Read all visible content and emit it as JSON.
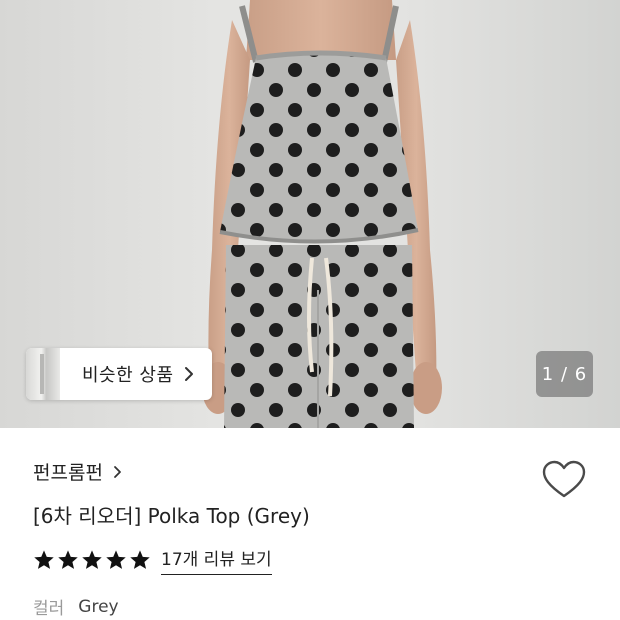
{
  "gallery": {
    "similar_button_label": "비슷한 상품",
    "page_indicator": "1 / 6",
    "current_page": 1,
    "total_pages": 6
  },
  "product": {
    "brand": "펀프롬펀",
    "title": "[6차 리오더] Polka Top (Grey)",
    "rating_stars": 5,
    "review_link": "17개 리뷰 보기",
    "option_label": "컬러",
    "option_value": "Grey",
    "favorited": false
  },
  "colors": {
    "fabric": "#b9b9b7",
    "dots": "#1e1e1e",
    "star": "#111111",
    "heart_stroke": "#4a4a4a"
  },
  "icons": {
    "similar_chevron": "chevron-right-icon",
    "brand_chevron": "chevron-right-icon",
    "favorite": "heart-outline-icon",
    "rating": "star-filled-icon"
  }
}
